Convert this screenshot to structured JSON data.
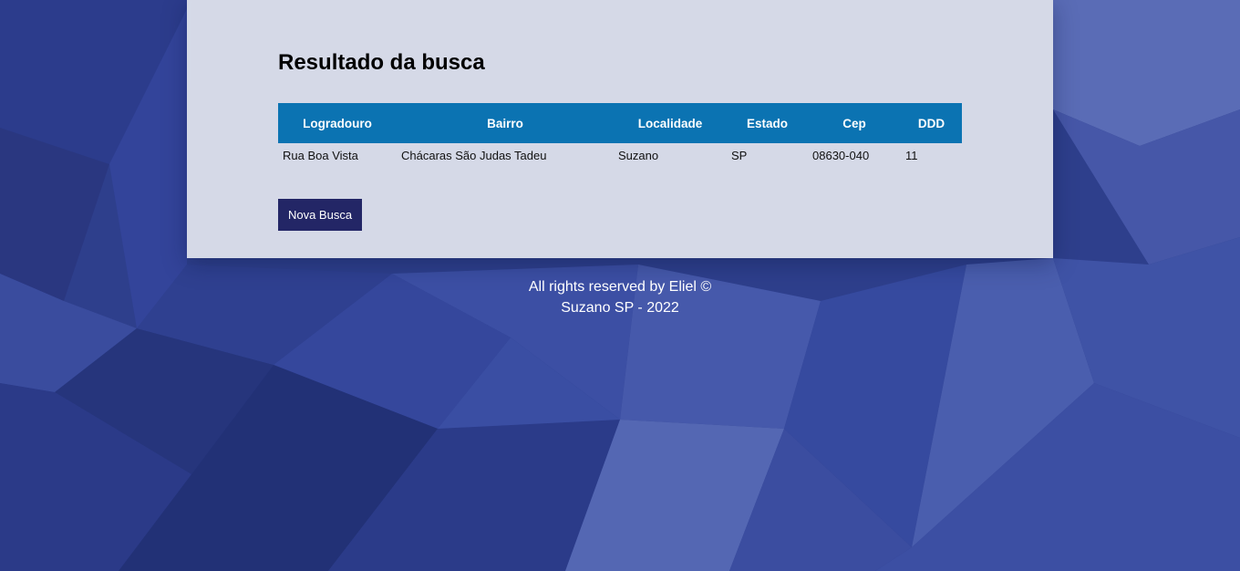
{
  "page": {
    "title": "Resultado da busca",
    "new_search_label": "Nova Busca"
  },
  "table": {
    "headers": [
      "Logradouro",
      "Bairro",
      "Localidade",
      "Estado",
      "Cep",
      "DDD"
    ],
    "rows": [
      [
        "Rua Boa Vista",
        "Chácaras São Judas Tadeu",
        "Suzano",
        "SP",
        "08630-040",
        "11"
      ]
    ]
  },
  "footer": {
    "line1": "All rights reserved by Eliel ©",
    "line2": "Suzano SP - 2022"
  },
  "colors": {
    "header_bg": "#0b73b2",
    "button_bg": "#232666",
    "page_bg": "#2e3f8c"
  }
}
